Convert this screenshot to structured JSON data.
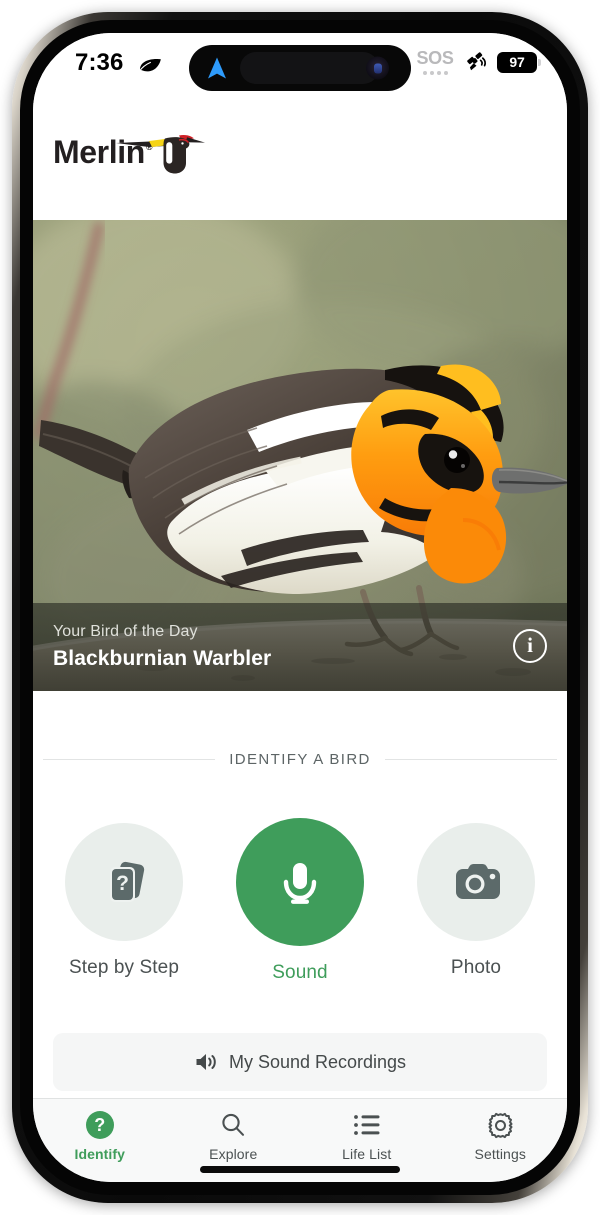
{
  "status_bar": {
    "time": "7:36",
    "leaf_icon": "leaf-icon",
    "location_icon": "location-arrow-icon",
    "sos_label": "SOS",
    "satellite_icon": "satellite-icon",
    "battery_level": "97"
  },
  "app": {
    "name": "Merlin",
    "logo_icon": "merlin-bird-logo",
    "trademark": "®"
  },
  "hero": {
    "subtitle": "Your Bird of the Day",
    "title": "Blackburnian Warbler",
    "info_icon": "info-icon",
    "info_glyph": "i"
  },
  "identify_section": {
    "header": "IDENTIFY A BIRD",
    "actions": [
      {
        "label": "Step by Step",
        "icon": "cards-question-icon",
        "active": false
      },
      {
        "label": "Sound",
        "icon": "microphone-icon",
        "active": true
      },
      {
        "label": "Photo",
        "icon": "camera-icon",
        "active": false
      }
    ],
    "recordings_button": {
      "label": "My Sound Recordings",
      "icon": "speaker-sound-icon"
    }
  },
  "tab_bar": {
    "tabs": [
      {
        "label": "Identify",
        "icon": "question-circle-icon",
        "active": true
      },
      {
        "label": "Explore",
        "icon": "search-icon",
        "active": false
      },
      {
        "label": "Life List",
        "icon": "list-icon",
        "active": false
      },
      {
        "label": "Settings",
        "icon": "gear-icon",
        "active": false
      }
    ],
    "identify_glyph": "?"
  },
  "colors": {
    "accent_green": "#3F9D5B",
    "icon_slate": "#5C6A6A",
    "chip_bg": "#E9EEEB",
    "recordings_bg": "#F5F6F6",
    "tabbar_bg": "#F8F9F9"
  }
}
